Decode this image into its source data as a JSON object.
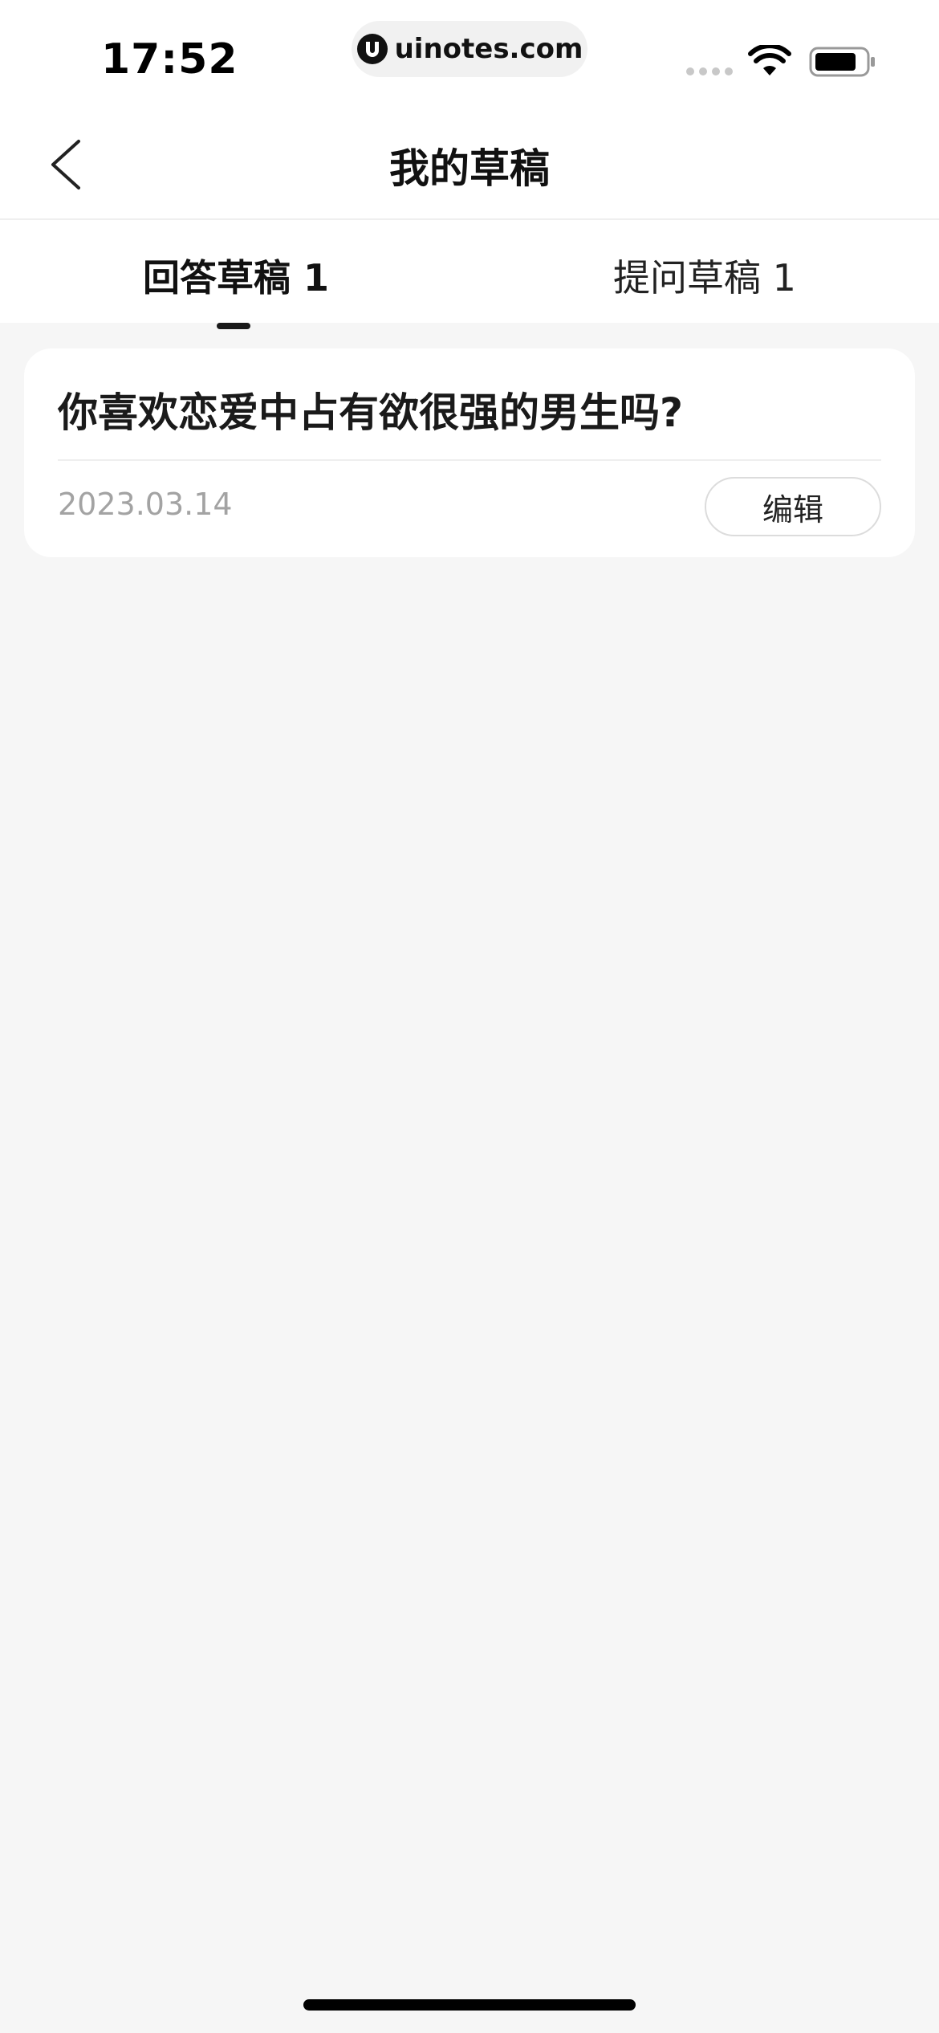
{
  "status_bar": {
    "time": "17:52",
    "url": "uinotes.com"
  },
  "nav": {
    "title": "我的草稿",
    "back_icon": "chevron-left-icon"
  },
  "tabs": [
    {
      "label": "回答草稿 1",
      "active": true
    },
    {
      "label": "提问草稿 1",
      "active": false
    }
  ],
  "drafts": [
    {
      "title": "你喜欢恋爱中占有欲很强的男生吗?",
      "date": "2023.03.14",
      "edit_label": "编辑"
    }
  ],
  "colors": {
    "background": "#f6f6f6",
    "card": "#ffffff",
    "date_text": "#a3a3a3",
    "indicator": "#1a1a1a"
  }
}
